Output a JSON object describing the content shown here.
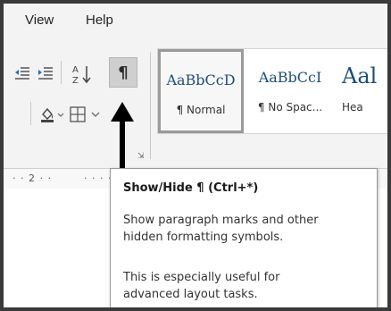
{
  "menu": {
    "view_label": "View",
    "help_label": "Help"
  },
  "ribbon": {
    "pilcrow_glyph": "¶",
    "sort_glyph": "A↓Z",
    "launcher_glyph": "⇲"
  },
  "styles": {
    "items": [
      {
        "preview": "AaBbCcD",
        "name": "¶ Normal"
      },
      {
        "preview": "AaBbCcI",
        "name": "¶ No Spac..."
      },
      {
        "preview": "Aal",
        "name": "Hea"
      }
    ]
  },
  "ruler": {
    "mark_2": "· · 2 · ·",
    "dots_right": "· · · ·"
  },
  "tooltip": {
    "title": "Show/Hide ¶ (Ctrl+*)",
    "line1": "Show paragraph marks and other",
    "line2": "hidden formatting symbols.",
    "line3": "This is especially useful for",
    "line4": "advanced layout tasks."
  },
  "colors": {
    "accent_preview": "#1f4e79",
    "arrow": "#000000"
  }
}
